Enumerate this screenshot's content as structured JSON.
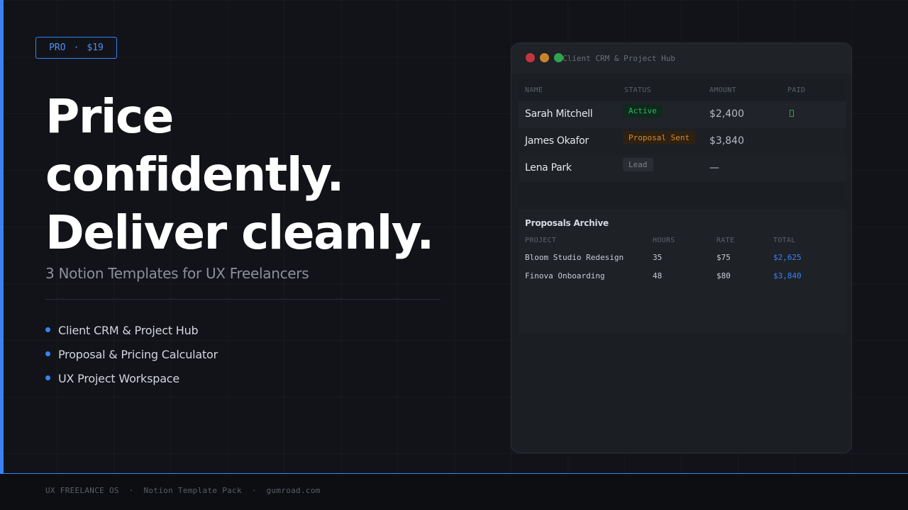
{
  "badge": {
    "tier": "PRO",
    "separator": "·",
    "price": "$19"
  },
  "headline": {
    "line1": "Price",
    "line2": "confidently.",
    "line3": "Deliver cleanly."
  },
  "subtitle": "3 Notion Templates for UX Freelancers",
  "features": [
    {
      "label": "Client CRM & Project Hub"
    },
    {
      "label": "Proposal & Pricing Calculator"
    },
    {
      "label": "UX Project Workspace"
    }
  ],
  "window": {
    "title": "Client CRM & Project Hub",
    "crm": {
      "headers": {
        "name": "NAME",
        "status": "STATUS",
        "amount": "AMOUNT",
        "paid": "PAID"
      },
      "rows": [
        {
          "name": "Sarah Mitchell",
          "status": "Active",
          "amount": "$2,400",
          "paid": true
        },
        {
          "name": "James Okafor",
          "status": "Proposal Sent",
          "amount": "$3,840",
          "paid": false
        },
        {
          "name": "Lena Park",
          "status": "Lead",
          "amount": "—",
          "paid": false
        }
      ]
    },
    "archive": {
      "title": "Proposals Archive",
      "headers": {
        "project": "PROJECT",
        "hours": "HOURS",
        "rate": "RATE",
        "total": "TOTAL"
      },
      "rows": [
        {
          "project": "Bloom Studio Redesign",
          "hours": "35",
          "rate": "$75",
          "total": "$2,625"
        },
        {
          "project": "Finova Onboarding",
          "hours": "48",
          "rate": "$80",
          "total": "$3,840"
        }
      ]
    }
  },
  "footer": {
    "text": "UX FREELANCE OS  ·  Notion Template Pack  ·  gumroad.com"
  },
  "colors": {
    "accent": "#3b82f6",
    "active": "#31b463",
    "sent": "#d48b2e",
    "background": "#111318"
  }
}
